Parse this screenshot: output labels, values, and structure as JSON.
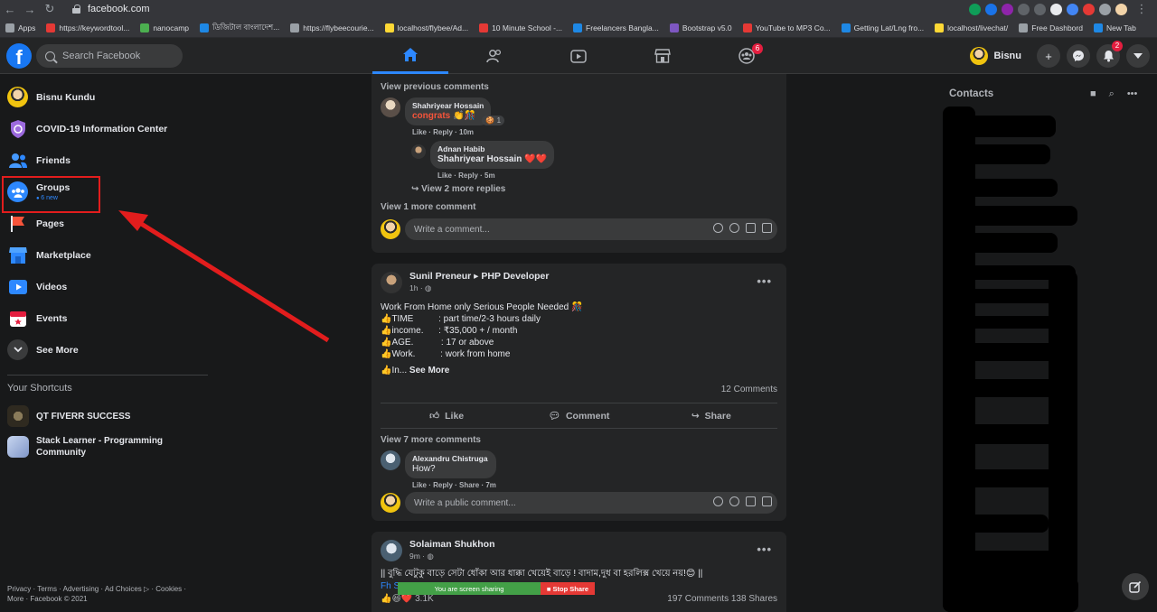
{
  "browser": {
    "url": "facebook.com",
    "bookmarks": [
      {
        "label": "Apps",
        "color": "#9aa0a6"
      },
      {
        "label": "https://keywordtool...",
        "color": "#e53935"
      },
      {
        "label": "nanocamp",
        "color": "#4caf50"
      },
      {
        "label": "ডিজিটাল বাংলাদেশ...",
        "color": "#1e88e5"
      },
      {
        "label": "https://flybeecourie...",
        "color": "#9aa0a6"
      },
      {
        "label": "localhost/flybee/Ad...",
        "color": "#fdd835"
      },
      {
        "label": "10 Minute School -...",
        "color": "#e53935"
      },
      {
        "label": "Freelancers Bangla...",
        "color": "#1e88e5"
      },
      {
        "label": "Bootstrap v5.0",
        "color": "#7e57c2"
      },
      {
        "label": "YouTube to MP3 Co...",
        "color": "#e53935"
      },
      {
        "label": "Getting Lat/Lng fro...",
        "color": "#1e88e5"
      },
      {
        "label": "localhost/livechat/",
        "color": "#fdd835"
      },
      {
        "label": "Free Dashbord",
        "color": "#9aa0a6"
      },
      {
        "label": "New Tab",
        "color": "#1e88e5"
      }
    ]
  },
  "header": {
    "logo": "f",
    "search_placeholder": "Search Facebook",
    "groups_badge": "6",
    "profile_name": "Bisnu",
    "notifications_badge": "2"
  },
  "sidebar": {
    "items": [
      {
        "label": "Bisnu Kundu",
        "icon": "avatar",
        "color": ""
      },
      {
        "label": "COVID-19 Information Center",
        "icon": "shield-icon",
        "color": "#7c4dff"
      },
      {
        "label": "Friends",
        "icon": "friends-icon",
        "color": "#2d88ff"
      },
      {
        "label": "Groups",
        "icon": "groups-icon",
        "color": "#2d88ff",
        "sub": "6 new"
      },
      {
        "label": "Pages",
        "icon": "flag-icon",
        "color": "#f7543a"
      },
      {
        "label": "Marketplace",
        "icon": "shop-icon",
        "color": "#2d88ff"
      },
      {
        "label": "Videos",
        "icon": "video-icon",
        "color": "#2d88ff"
      },
      {
        "label": "Events",
        "icon": "calendar-icon",
        "color": "#e41e3f"
      },
      {
        "label": "See More",
        "icon": "chevron-down-icon",
        "color": "#3a3b3c"
      }
    ],
    "shortcuts_heading": "Your Shortcuts",
    "shortcuts": [
      {
        "label": "QT FIVERR SUCCESS"
      },
      {
        "label": "Stack Learner - Programming Community"
      }
    ],
    "footer_line1": "Privacy · Terms · Advertising · Ad Choices ▷ · Cookies ·",
    "footer_line2": "More · Facebook © 2021"
  },
  "feed": {
    "card1": {
      "view_previous": "View previous comments",
      "comment1": {
        "name": "Shahriyear Hossain",
        "text": "congrats 👏🎊",
        "reaction_count": "1",
        "meta": "Like · Reply · 10m"
      },
      "reply1": {
        "name": "Adnan Habib",
        "text": "Shahriyear Hossain ❤️❤️",
        "meta": "Like · Reply · 5m"
      },
      "view_more_replies": "View 2 more replies",
      "view_more_comment": "View 1 more comment",
      "write_placeholder": "Write a comment..."
    },
    "post2": {
      "author": "Sunil Preneur ▸ PHP Developer",
      "time": "1h · ",
      "text": "Work From Home only Serious People Needed 🎊\n👍TIME          : part time/2-3 hours daily\n👍income.      : ₹35,000 + / month\n👍AGE.           : 17 or above\n👍Work.          : work from home",
      "last_line": "👍In... ",
      "see_more": "See More",
      "comments_count": "12 Comments",
      "like": "Like",
      "comment": "Comment",
      "share": "Share",
      "view_more_comments": "View 7 more comments",
      "comment1": {
        "name": "Alexandru Chistruga",
        "text": "How?",
        "meta": "Like · Reply · Share · 7m"
      },
      "write_placeholder": "Write a public comment..."
    },
    "post3": {
      "author": "Solaiman Shukhon",
      "time": "9m · ",
      "text": "|| বুদ্ধি যেটুকু বাড়ে সেটা ধোঁকা আর ধাক্কা খেয়েই বাড়ে ! বাদাম,দুধ বা হরলিক্স খেয়ে নয়!😊 ||",
      "link_partial": "Fh S",
      "reactions_count": "3.1K",
      "comments_shares": "197 Comments  138 Shares"
    }
  },
  "screen_share": {
    "status": "You are screen sharing",
    "stop": "Stop Share"
  },
  "contacts": {
    "title": "Contacts"
  }
}
